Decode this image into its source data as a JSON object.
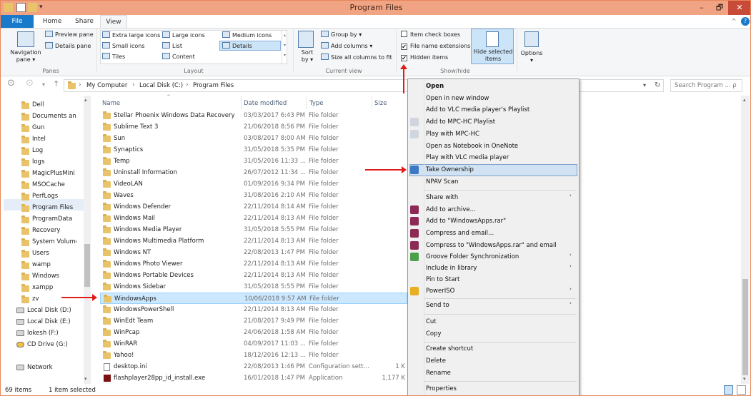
{
  "window": {
    "title": "Program Files",
    "minimize_glyph": "–",
    "maximize_glyph": "🗗",
    "close_glyph": "✕"
  },
  "tabs": {
    "file": "File",
    "home": "Home",
    "share": "Share",
    "view": "View"
  },
  "ribbon": {
    "panes": {
      "navigation_pane": "Navigation pane ▾",
      "preview_pane": "Preview pane",
      "details_pane": "Details pane",
      "label": "Panes"
    },
    "layout": {
      "items": [
        "Extra large icons",
        "Large icons",
        "Medium icons",
        "Small icons",
        "List",
        "Details",
        "Tiles",
        "Content"
      ],
      "label": "Layout"
    },
    "current_view": {
      "sort_by": "Sort by ▾",
      "group_by": "Group by ▾",
      "add_columns": "Add columns ▾",
      "size_all_columns": "Size all columns to fit",
      "label": "Current view"
    },
    "show_hide": {
      "item_check_boxes": "Item check boxes",
      "file_name_extensions": "File name extensions",
      "hidden_items": "Hidden items",
      "hide_selected_items": "Hide selected items",
      "label": "Show/hide"
    },
    "options": "Options",
    "options_dropdown_glyph": "▾",
    "collapse_glyph": "^",
    "help_glyph": "?"
  },
  "address": {
    "back": "⊙",
    "forward": "⊙",
    "recent": "▾",
    "up": "↑",
    "path": [
      "My Computer",
      "Local Disk (C:)",
      "Program Files"
    ],
    "path_sep": "›",
    "dropdown_glyph": "▾",
    "refresh_glyph": "↻",
    "search_placeholder": "Search Program ... ρ"
  },
  "nav_pane": {
    "items": [
      "Dell",
      "Documents and",
      "Gun",
      "Intel",
      "Log",
      "logs",
      "MagicPlusMini",
      "MSOCache",
      "PerfLogs",
      "Program Files",
      "ProgramData",
      "Recovery",
      "System Volume",
      "Users",
      "wamp",
      "Windows",
      "xampp",
      "zv",
      "Local Disk (D:)",
      "Local Disk (E:)",
      "lokesh (F:)",
      "CD Drive (G:)",
      "Network"
    ],
    "selected": "Program Files"
  },
  "columns": {
    "name": "Name",
    "date": "Date modified",
    "type": "Type",
    "size": "Size"
  },
  "files": [
    {
      "name": "Stellar Phoenix Windows Data Recovery",
      "date": "03/03/2017 6:43 PM",
      "type": "File folder",
      "size": ""
    },
    {
      "name": "Sublime Text 3",
      "date": "21/06/2018 8:56 PM",
      "type": "File folder",
      "size": ""
    },
    {
      "name": "Sun",
      "date": "03/08/2017 8:00 AM",
      "type": "File folder",
      "size": ""
    },
    {
      "name": "Synaptics",
      "date": "31/05/2018 5:35 PM",
      "type": "File folder",
      "size": ""
    },
    {
      "name": "Temp",
      "date": "31/05/2016 11:33 ...",
      "type": "File folder",
      "size": ""
    },
    {
      "name": "Uninstall Information",
      "date": "26/07/2012 11:34 ...",
      "type": "File folder",
      "size": ""
    },
    {
      "name": "VideoLAN",
      "date": "01/09/2016 9:34 PM",
      "type": "File folder",
      "size": ""
    },
    {
      "name": "Waves",
      "date": "31/08/2016 2:10 AM",
      "type": "File folder",
      "size": ""
    },
    {
      "name": "Windows Defender",
      "date": "22/11/2014 8:14 AM",
      "type": "File folder",
      "size": ""
    },
    {
      "name": "Windows Mail",
      "date": "22/11/2014 8:13 AM",
      "type": "File folder",
      "size": ""
    },
    {
      "name": "Windows Media Player",
      "date": "31/05/2018 5:55 PM",
      "type": "File folder",
      "size": ""
    },
    {
      "name": "Windows Multimedia Platform",
      "date": "22/11/2014 8:13 AM",
      "type": "File folder",
      "size": ""
    },
    {
      "name": "Windows NT",
      "date": "22/08/2013 1:47 PM",
      "type": "File folder",
      "size": ""
    },
    {
      "name": "Windows Photo Viewer",
      "date": "22/11/2014 8:13 AM",
      "type": "File folder",
      "size": ""
    },
    {
      "name": "Windows Portable Devices",
      "date": "22/11/2014 8:13 AM",
      "type": "File folder",
      "size": ""
    },
    {
      "name": "Windows Sidebar",
      "date": "31/05/2018 5:55 PM",
      "type": "File folder",
      "size": ""
    },
    {
      "name": "WindowsApps",
      "date": "10/06/2018 9:57 AM",
      "type": "File folder",
      "size": ""
    },
    {
      "name": "WindowsPowerShell",
      "date": "22/11/2014 8:13 AM",
      "type": "File folder",
      "size": ""
    },
    {
      "name": "WinEdt Team",
      "date": "21/08/2017 9:49 PM",
      "type": "File folder",
      "size": ""
    },
    {
      "name": "WinPcap",
      "date": "24/06/2018 1:58 AM",
      "type": "File folder",
      "size": ""
    },
    {
      "name": "WinRAR",
      "date": "04/09/2017 11:03 ...",
      "type": "File folder",
      "size": ""
    },
    {
      "name": "Yahoo!",
      "date": "18/12/2016 12:13 ...",
      "type": "File folder",
      "size": ""
    },
    {
      "name": "desktop.ini",
      "date": "22/08/2013 1:46 PM",
      "type": "Configuration sett...",
      "size": "1 K"
    },
    {
      "name": "flashplayer28pp_id_install.exe",
      "date": "16/01/2018 1:47 PM",
      "type": "Application",
      "size": "1,177 K"
    }
  ],
  "selected_file": "WindowsApps",
  "context_menu": {
    "items": [
      {
        "label": "Open",
        "bold": true
      },
      {
        "label": "Open in new window"
      },
      {
        "label": "Add to VLC media player's Playlist"
      },
      {
        "label": "Add to MPC-HC Playlist"
      },
      {
        "label": "Play with MPC-HC"
      },
      {
        "label": "Open as Notebook in OneNote"
      },
      {
        "label": "Play with VLC media player"
      },
      {
        "label": "Take Ownership"
      },
      {
        "label": "NPAV Scan"
      },
      {
        "label": "Share with",
        "submenu": true
      },
      {
        "label": "Add to archive..."
      },
      {
        "label": "Add to \"WindowsApps.rar\""
      },
      {
        "label": "Compress and email..."
      },
      {
        "label": "Compress to \"WindowsApps.rar\" and email"
      },
      {
        "label": "Groove Folder Synchronization",
        "submenu": true
      },
      {
        "label": "Include in library",
        "submenu": true
      },
      {
        "label": "Pin to Start"
      },
      {
        "label": "PowerISO",
        "submenu": true
      },
      {
        "label": "Send to",
        "submenu": true
      },
      {
        "label": "Cut"
      },
      {
        "label": "Copy"
      },
      {
        "label": "Create shortcut"
      },
      {
        "label": "Delete"
      },
      {
        "label": "Rename"
      },
      {
        "label": "Properties"
      }
    ],
    "highlighted": "Take Ownership",
    "submenu_glyph": "›"
  },
  "status": {
    "item_count": "69 items",
    "selection": "1 item selected"
  },
  "colors": {
    "titlebar": "#f1a483",
    "accent": "#1979ca",
    "selection": "#cce8ff",
    "annotation": "#e01b1b"
  }
}
